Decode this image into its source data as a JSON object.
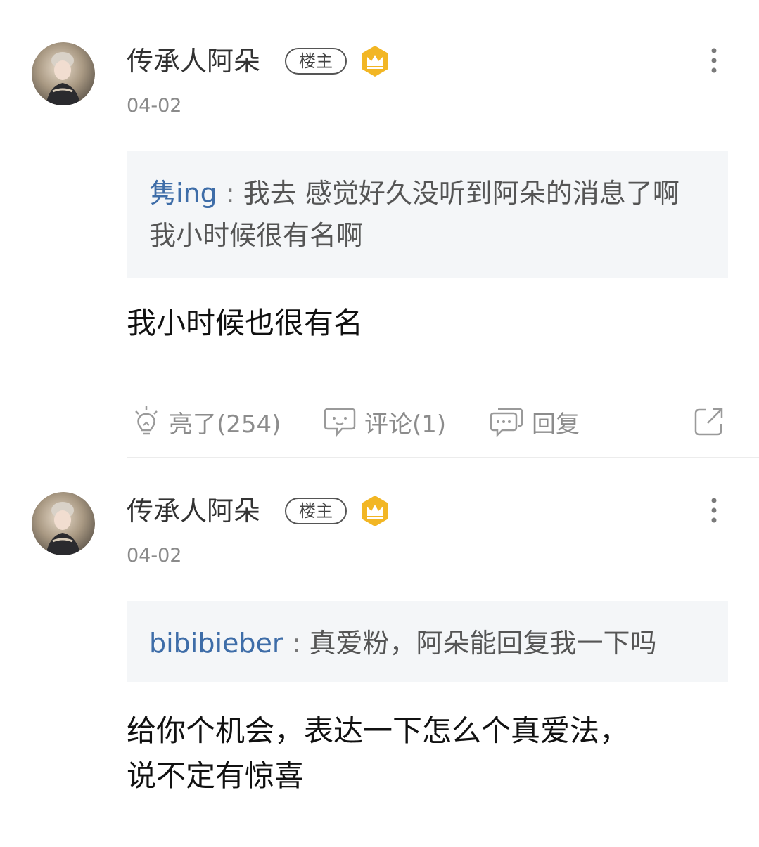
{
  "colors": {
    "quote_user": "#3e6da8",
    "quote_bg": "#f4f6f8",
    "badge_gold": "#f2b624",
    "meta_gray": "#8a8a8a"
  },
  "posts": [
    {
      "author": "传承人阿朵",
      "host_badge": "楼主",
      "badge_icon": "crown-icon",
      "date": "04-02",
      "quote": {
        "user": "隽ing",
        "separator": " : ",
        "text": "我去 感觉好久没听到阿朵的消息了啊 我小时候很有名啊"
      },
      "reply": "我小时候也很有名",
      "actions": {
        "like": "亮了(254)",
        "comment": "评论(1)",
        "reply": "回复"
      }
    },
    {
      "author": "传承人阿朵",
      "host_badge": "楼主",
      "badge_icon": "crown-icon",
      "date": "04-02",
      "quote": {
        "user": "bibibieber",
        "separator": " : ",
        "text": "真爱粉，阿朵能回复我一下吗"
      },
      "reply_lines": [
        "给你个机会，表达一下怎么个真爱法，",
        "说不定有惊喜"
      ]
    }
  ]
}
